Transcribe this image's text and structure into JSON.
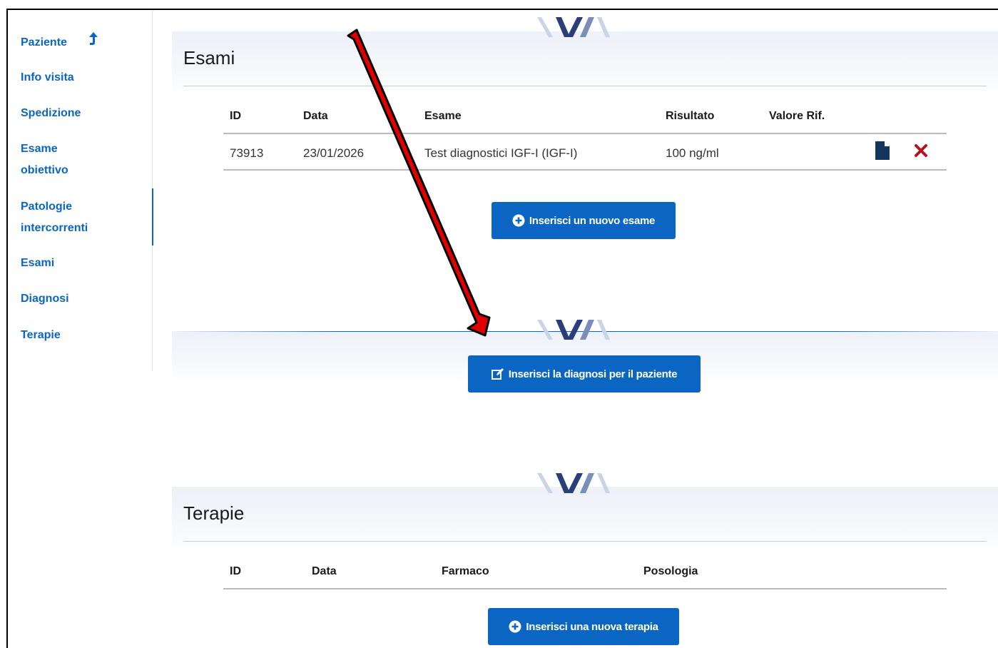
{
  "sidebar": {
    "items": [
      {
        "label": "Paziente"
      },
      {
        "label": "Info visita"
      },
      {
        "label": "Spedizione"
      },
      {
        "label": "Esame"
      },
      {
        "label": "obiettivo"
      },
      {
        "label": "Patologie"
      },
      {
        "label": "intercorrenti"
      },
      {
        "label": "Esami"
      },
      {
        "label": "Diagnosi"
      },
      {
        "label": "Terapie"
      }
    ],
    "paziente_arrow": "⮥"
  },
  "esami": {
    "title": "Esami",
    "headers": {
      "id": "ID",
      "data": "Data",
      "esame": "Esame",
      "risultato": "Risultato",
      "valore": "Valore Rif."
    },
    "rows": [
      {
        "id": "73913",
        "data": "23/01/2026",
        "esame": "Test diagnostici IGF-I (IGF-I)",
        "risultato": "100 ng/ml",
        "valore": ""
      }
    ],
    "add_button": "Inserisci un nuovo esame"
  },
  "diagnosi": {
    "button": "Inserisci la diagnosi per il paziente"
  },
  "terapie": {
    "title": "Terapie",
    "headers": {
      "id": "ID",
      "data": "Data",
      "farmaco": "Farmaco",
      "posologia": "Posologia"
    },
    "add_button": "Inserisci una nuova terapia"
  },
  "colors": {
    "primary": "#0b66c3",
    "danger": "#b3121f",
    "annotation": "#e00000"
  }
}
